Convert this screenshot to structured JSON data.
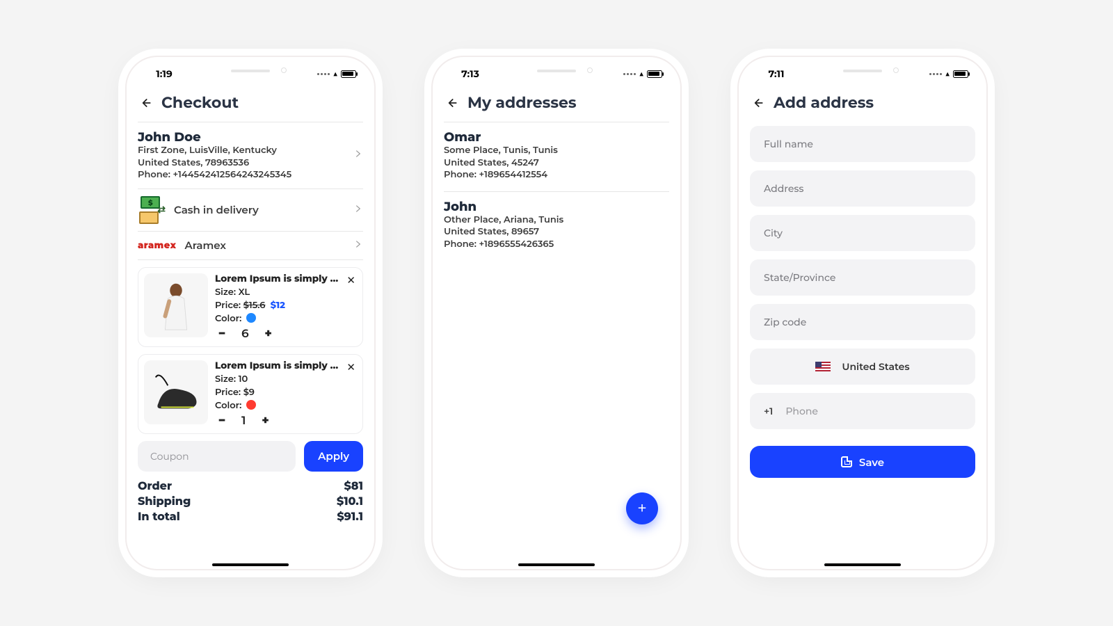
{
  "status_times": {
    "checkout": "1:19",
    "addresses": "7:13",
    "add": "7:11"
  },
  "checkout": {
    "title": "Checkout",
    "shipTo": {
      "name": "John Doe",
      "line1": "First Zone, LuisVille, Kentucky",
      "line2": "United States, 78963536",
      "phone": "Phone: +14454241256424324534​5"
    },
    "payment": {
      "label": "Cash in delivery"
    },
    "shipping": {
      "carrier": "Aramex",
      "carrier_logo_text": "aramex"
    },
    "items": [
      {
        "title": "Lorem Ipsum is simply …",
        "size": "Size: XL",
        "price_label": "Price: ",
        "price_orig": "$15.6",
        "price_disc": "$12",
        "color_label": "Color:",
        "color": "#1e88ff",
        "qty": "6"
      },
      {
        "title": "Lorem Ipsum is simply …",
        "size": "Size: 10",
        "price_label": "Price: ",
        "price_orig": "$9",
        "price_disc": "",
        "color_label": "Color:",
        "color": "#ff3b30",
        "qty": "1"
      }
    ],
    "coupon_placeholder": "Coupon",
    "apply": "Apply",
    "summary": {
      "order_l": "Order",
      "order_v": "$81",
      "ship_l": "Shipping",
      "ship_v": "$10.1",
      "total_l": "In total",
      "total_v": "$91.1"
    }
  },
  "addresses": {
    "title": "My addresses",
    "list": [
      {
        "name": "Omar",
        "line1": "Some Place, Tunis, Tunis",
        "line2": "United States, 45247",
        "phone": "Phone: +189654412554"
      },
      {
        "name": "John",
        "line1": "Other Place, Ariana, Tunis",
        "line2": "United States, 89657",
        "phone": "Phone: +1896555426365"
      }
    ]
  },
  "add": {
    "title": "Add address",
    "fields": {
      "fullname": "Full name",
      "address": "Address",
      "city": "City",
      "state": "State/Province",
      "zip": "Zip code"
    },
    "country": "United States",
    "phone_cc": "+1",
    "phone_ph": "Phone",
    "save": "Save"
  }
}
